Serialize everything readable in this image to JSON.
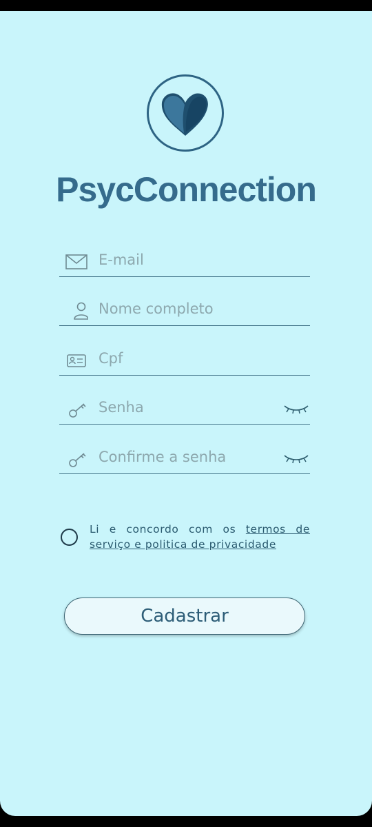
{
  "app": {
    "title": "PsycConnection",
    "accent_color": "#356b8c",
    "background_color": "#c9f5fb"
  },
  "form": {
    "fields": [
      {
        "placeholder": "E-mail",
        "icon": "mail-icon"
      },
      {
        "placeholder": "Nome completo",
        "icon": "user-icon"
      },
      {
        "placeholder": "Cpf",
        "icon": "id-card-icon"
      },
      {
        "placeholder": "Senha",
        "icon": "key-icon",
        "toggle_icon": "eye-closed-icon"
      },
      {
        "placeholder": "Confirme a senha",
        "icon": "key-icon",
        "toggle_icon": "eye-closed-icon"
      }
    ],
    "terms": {
      "prefix": "Li e concordo com os ",
      "link": "termos de serviço e politica de privacidade",
      "checked": false
    },
    "submit_label": "Cadastrar"
  }
}
